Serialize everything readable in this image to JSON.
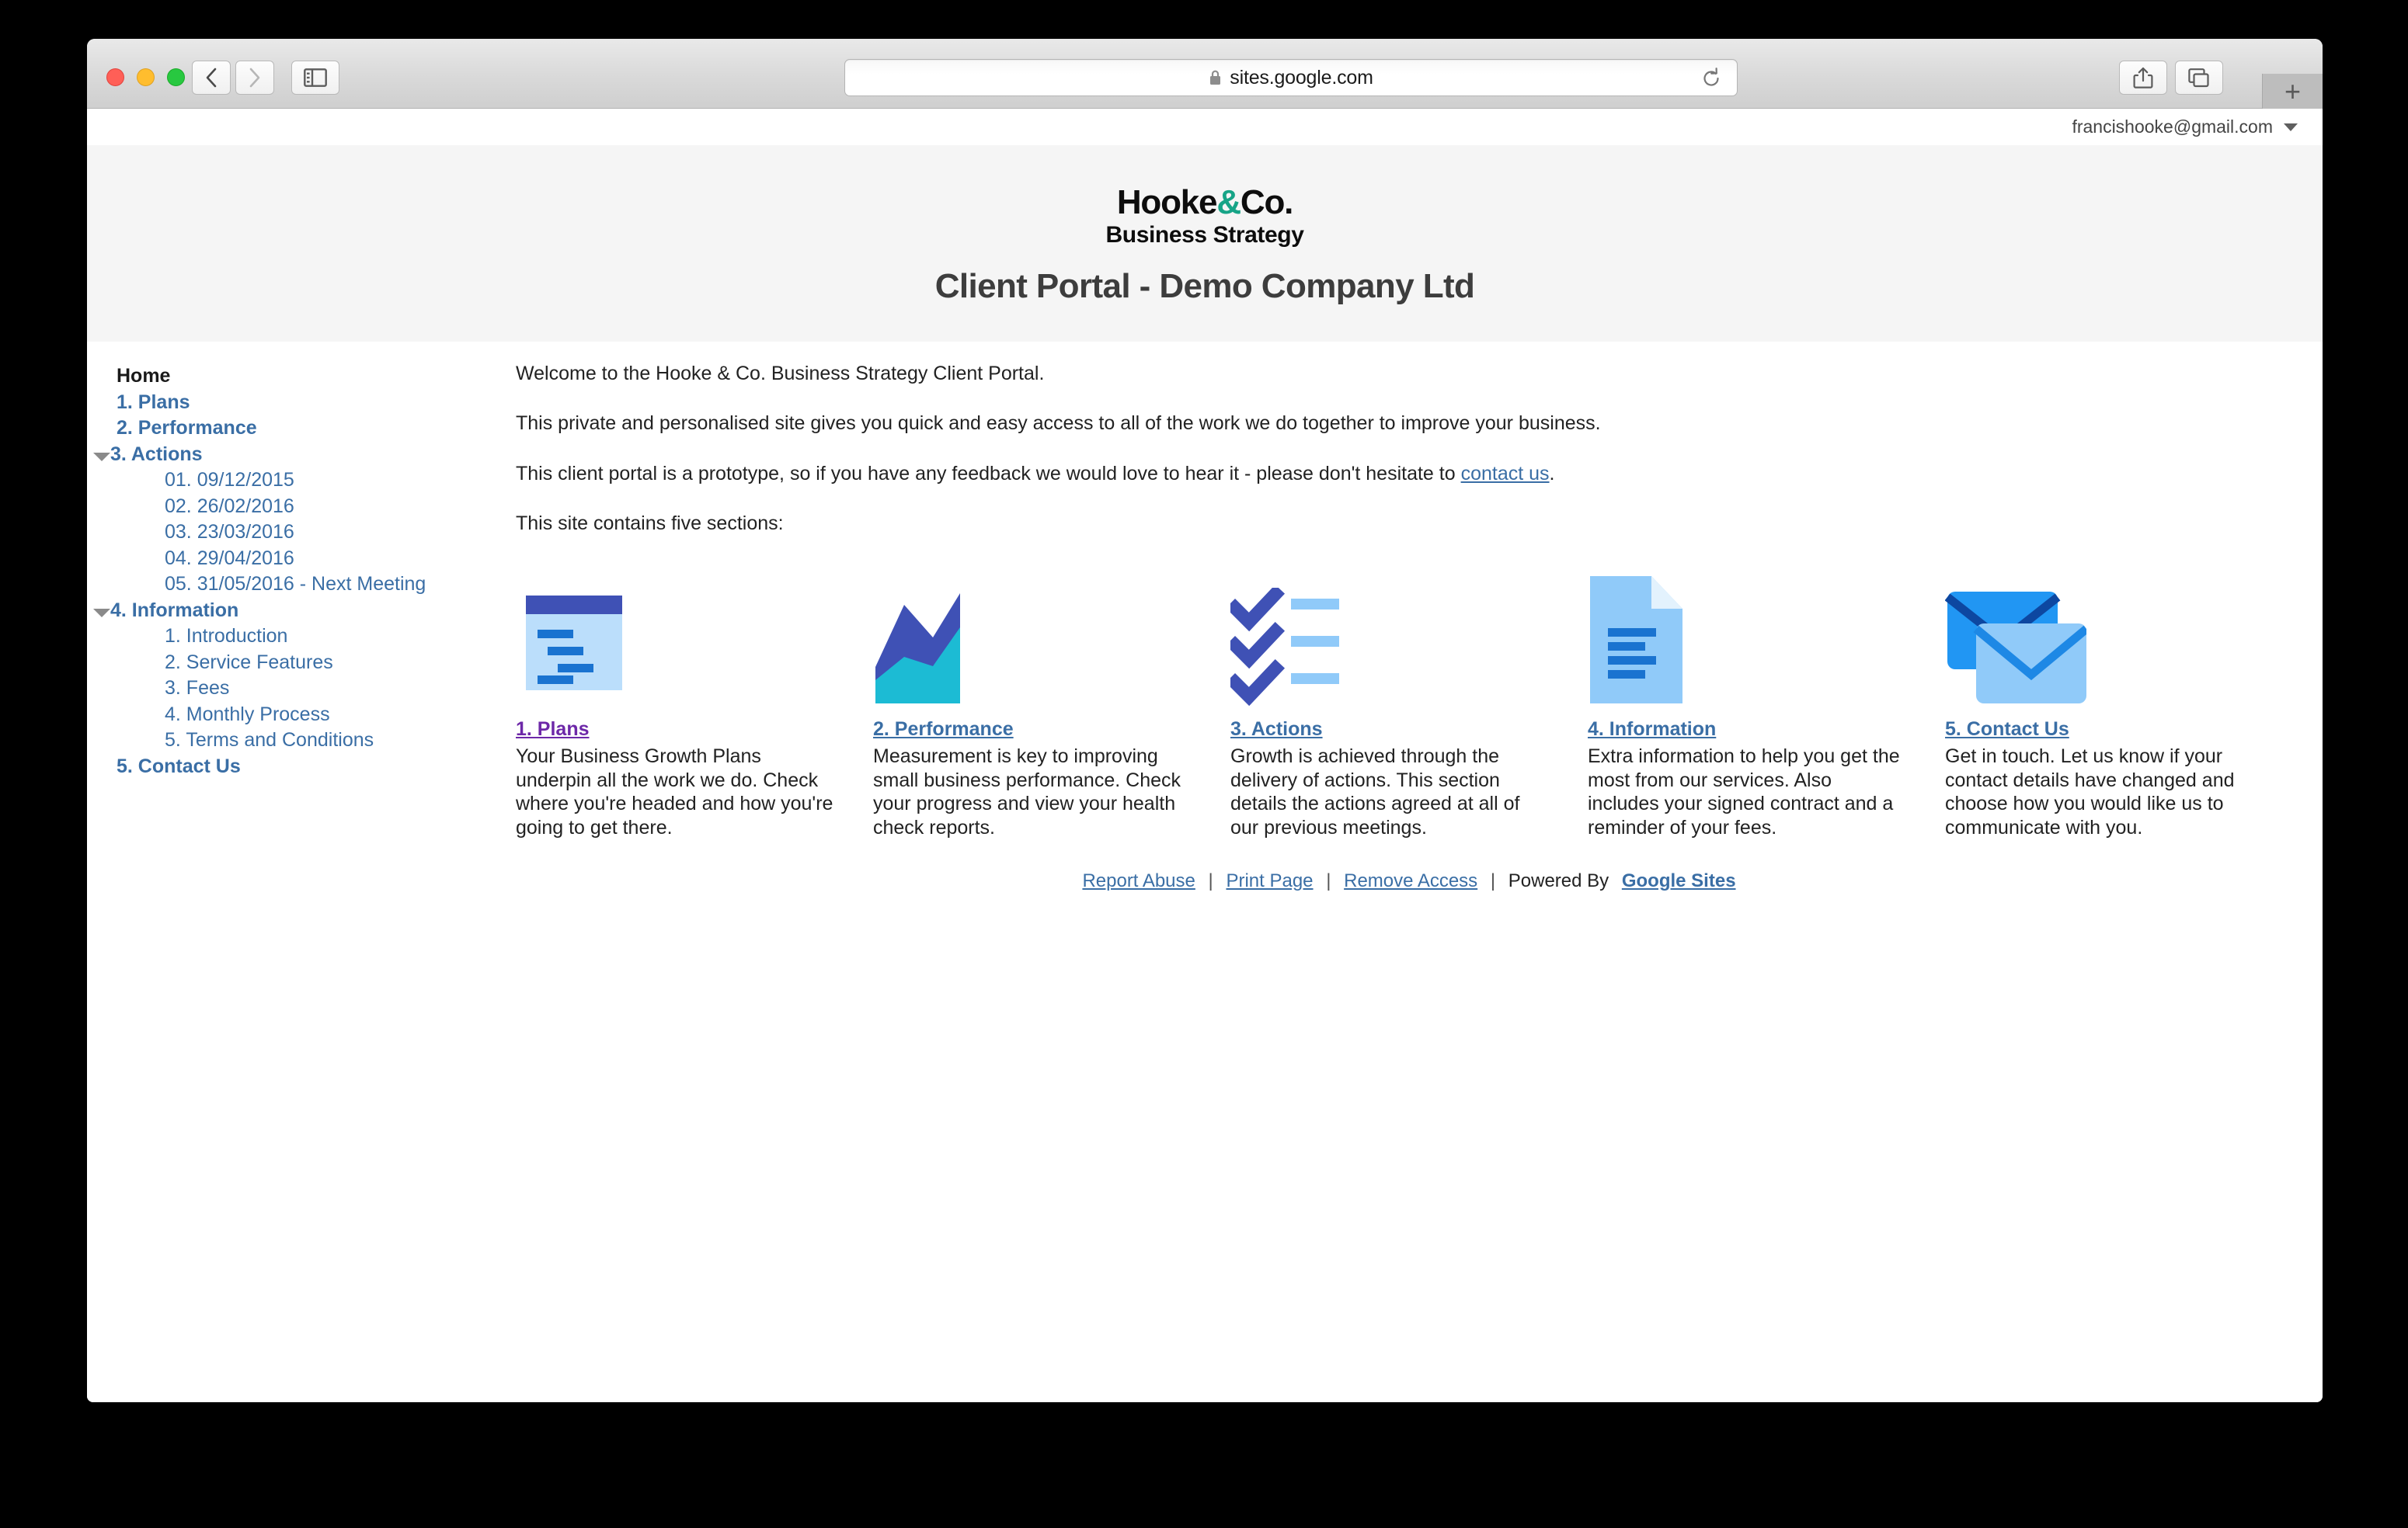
{
  "browser": {
    "url": "sites.google.com",
    "lock_icon": "lock-icon",
    "reload_icon": "reload-icon",
    "back_icon": "chevron-left-icon",
    "forward_icon": "chevron-right-icon",
    "sidebar_icon": "sidebar-toggle-icon",
    "share_icon": "share-icon",
    "tabs_icon": "tabs-overview-icon",
    "new_tab_label": "+"
  },
  "account": {
    "email": "francishooke@gmail.com",
    "caret_icon": "chevron-down-icon"
  },
  "site_header": {
    "logo_part1": "Hooke",
    "logo_amp": "&",
    "logo_part2": "Co.",
    "logo_tagline": "Business Strategy",
    "title": "Client Portal - Demo Company Ltd",
    "accent_color": "#17a487",
    "background_color": "#f5f5f5"
  },
  "sidebar": {
    "items": [
      {
        "label": "Home",
        "level": 1,
        "style": "home",
        "triangle": false
      },
      {
        "label": "1. Plans",
        "level": 1,
        "style": "top",
        "triangle": false
      },
      {
        "label": "2. Performance",
        "level": 1,
        "style": "top",
        "triangle": false
      },
      {
        "label": "3. Actions",
        "level": 1,
        "style": "top",
        "triangle": true
      },
      {
        "label": "01. 09/12/2015",
        "level": 2,
        "style": "sub",
        "triangle": false
      },
      {
        "label": "02. 26/02/2016",
        "level": 2,
        "style": "sub",
        "triangle": false
      },
      {
        "label": "03. 23/03/2016",
        "level": 2,
        "style": "sub",
        "triangle": false
      },
      {
        "label": "04. 29/04/2016",
        "level": 2,
        "style": "sub",
        "triangle": false
      },
      {
        "label": "05. 31/05/2016 - Next Meeting",
        "level": 2,
        "style": "sub",
        "triangle": false
      },
      {
        "label": "4. Information",
        "level": 1,
        "style": "top",
        "triangle": true
      },
      {
        "label": "1. Introduction",
        "level": 2,
        "style": "sub",
        "triangle": false
      },
      {
        "label": "2. Service Features",
        "level": 2,
        "style": "sub",
        "triangle": false
      },
      {
        "label": "3. Fees",
        "level": 2,
        "style": "sub",
        "triangle": false
      },
      {
        "label": "4. Monthly Process",
        "level": 2,
        "style": "sub",
        "triangle": false
      },
      {
        "label": "5. Terms and Conditions",
        "level": 2,
        "style": "sub",
        "triangle": false
      },
      {
        "label": "5. Contact Us",
        "level": 1,
        "style": "top",
        "triangle": false
      }
    ]
  },
  "main": {
    "paragraphs": [
      "Welcome to the Hooke & Co. Business Strategy Client Portal.",
      "This private and personalised site gives you quick and easy access to all of the work we do together to improve your business.",
      "This site contains five sections:"
    ],
    "prototype_line_before": "This client portal is a prototype, so if you have any feedback we would love to hear it - please don't hesitate to ",
    "prototype_link": "contact us",
    "prototype_line_after": ".",
    "cards": [
      {
        "title": "1. Plans",
        "icon": "plan-document-icon",
        "visited": true,
        "description": "Your Business Growth Plans underpin all the work we do. Check where you're headed and how you're going to get there."
      },
      {
        "title": "2. Performance",
        "icon": "area-chart-icon",
        "visited": false,
        "description": "Measurement is key to improving small business performance. Check your progress and view your health check reports."
      },
      {
        "title": "3. Actions",
        "icon": "checklist-icon",
        "visited": false,
        "description": "Growth is achieved through the delivery of actions. This section details the actions agreed at all of our previous meetings."
      },
      {
        "title": "4. Information",
        "icon": "document-icon",
        "visited": false,
        "description": "Extra information to help you get the most from our services. Also includes your signed contract and a reminder of your fees."
      },
      {
        "title": "5. Contact Us",
        "icon": "envelopes-icon",
        "visited": false,
        "description": "Get in touch. Let us know if your contact details have changed and choose how you would like us to communicate with you."
      }
    ]
  },
  "footer": {
    "report_abuse": "Report Abuse",
    "print_page": "Print Page",
    "remove_access": "Remove Access",
    "powered_by": "Powered By",
    "google_sites": "Google Sites",
    "separator": "|"
  }
}
